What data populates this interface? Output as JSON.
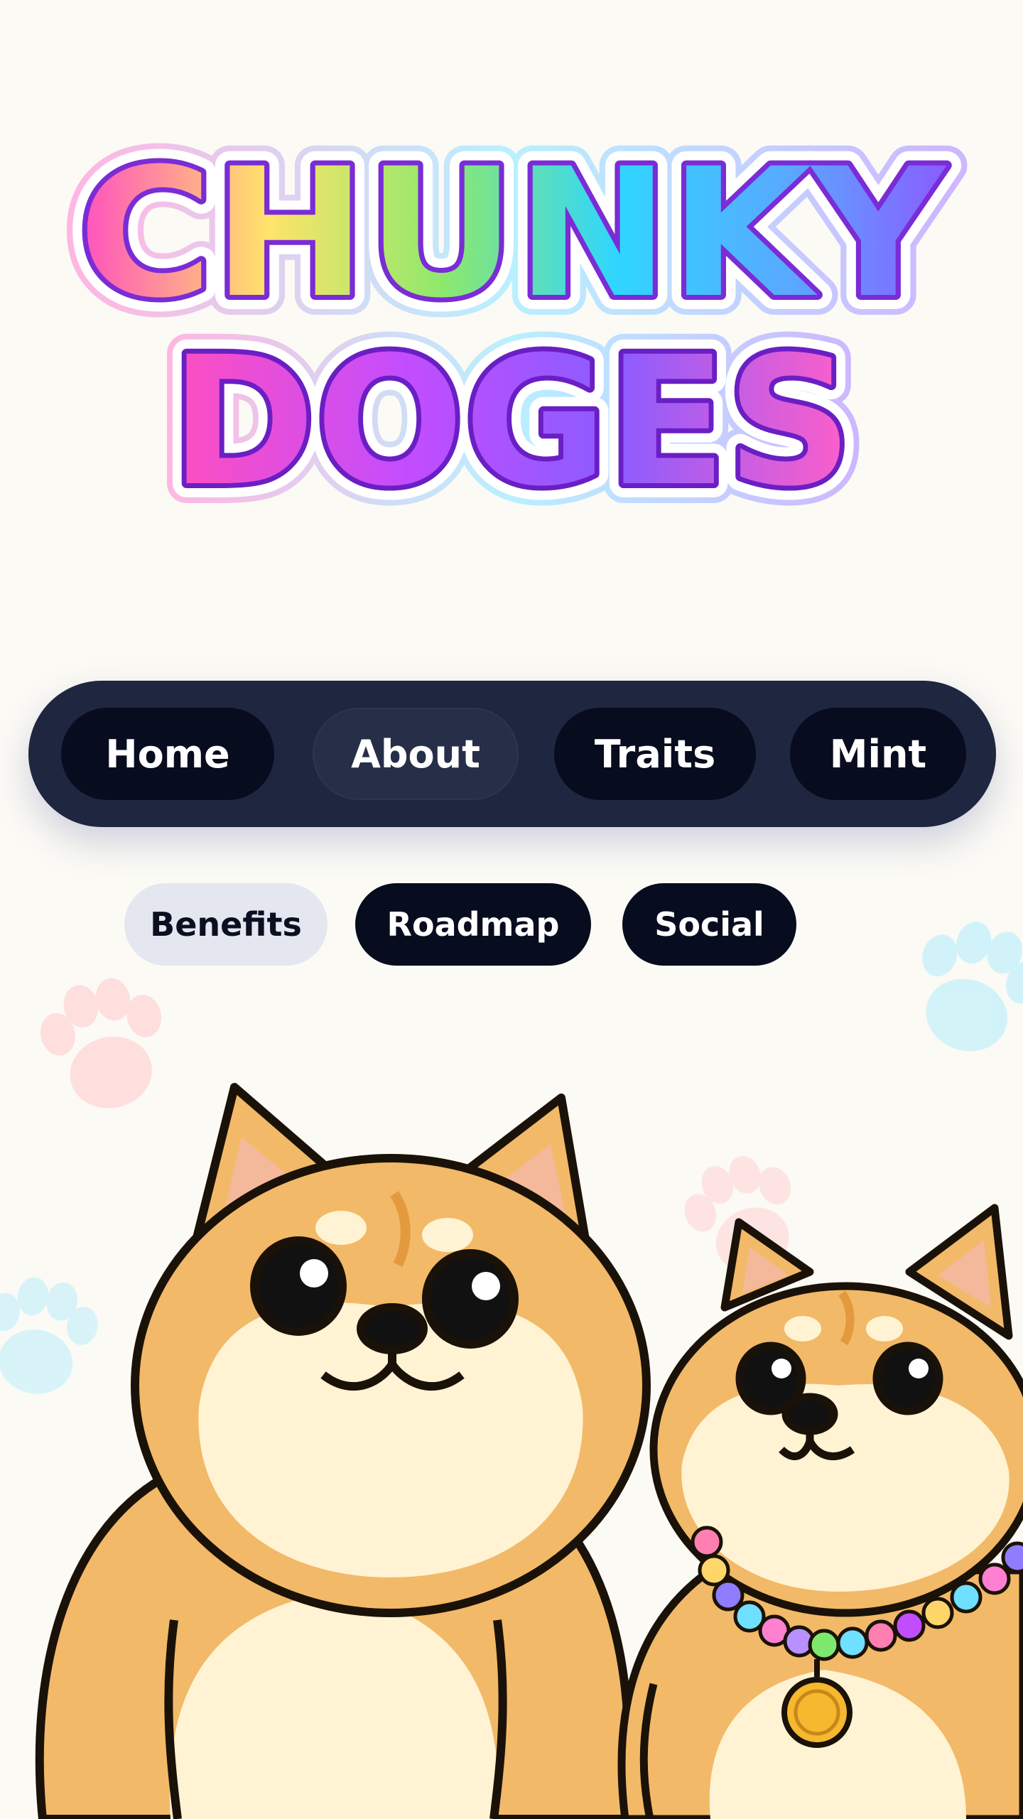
{
  "logo": {
    "line1": "CHUNKY",
    "line2": "DOGES"
  },
  "nav": {
    "items": [
      {
        "label": "Home",
        "active": false
      },
      {
        "label": "About",
        "active": true
      },
      {
        "label": "Traits",
        "active": false
      },
      {
        "label": "Mint",
        "active": false
      }
    ]
  },
  "subnav": {
    "items": [
      {
        "label": "Benefits",
        "active": true
      },
      {
        "label": "Roadmap",
        "active": false
      },
      {
        "label": "Social",
        "active": false
      }
    ]
  },
  "illustration": {
    "subject": "two-shiba-doges",
    "icons": [
      "paw-print-icon",
      "coin-pendant-icon"
    ]
  },
  "colors": {
    "nav_bg": "#1f2640",
    "pill_bg": "#080c1f",
    "pill_active": "#262e48",
    "sub_active": "#e4e7ef",
    "logo_gradient": [
      "#ff4fbf",
      "#ffe46a",
      "#7de86c",
      "#2fd6ff",
      "#7a5cff",
      "#c24dff"
    ],
    "logo_outline": "#7a2cd6",
    "doge_fur": "#f2b968",
    "doge_cream": "#fff3d3"
  }
}
